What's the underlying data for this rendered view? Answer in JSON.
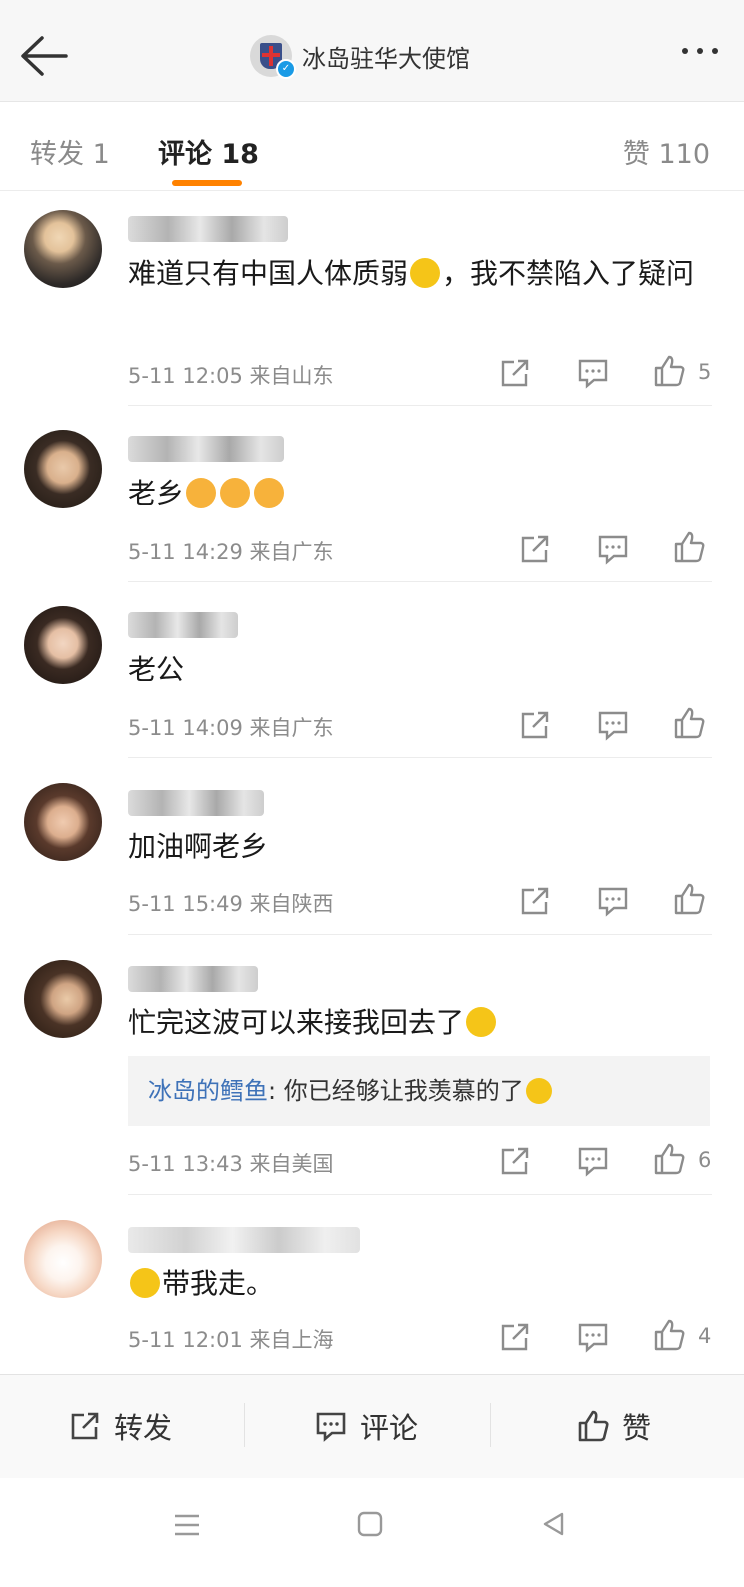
{
  "header": {
    "account_name": "冰岛驻华大使馆"
  },
  "tabs": {
    "repost": "转发 1",
    "comment": "评论 18",
    "like": "赞 110"
  },
  "comments": [
    {
      "text": "难道只有中国人体质弱",
      "text2": "，我不禁陷入了疑问",
      "time": "5-11 12:05",
      "location": "来自山东",
      "likes": "5"
    },
    {
      "text": "老乡",
      "time": "5-11 14:29",
      "location": "来自广东",
      "likes": ""
    },
    {
      "text": "老公",
      "time": "5-11 14:09",
      "location": "来自广东",
      "likes": ""
    },
    {
      "text": "加油啊老乡",
      "time": "5-11 15:49",
      "location": "来自陕西",
      "likes": ""
    },
    {
      "text": "忙完这波可以来接我回去了",
      "reply_name": "冰岛的鳕鱼",
      "reply_text": ": 你已经够让我羡慕的了",
      "time": "5-11 13:43",
      "location": "来自美国",
      "likes": "6"
    },
    {
      "text": "带我走。",
      "time": "5-11 12:01",
      "location": "来自上海",
      "likes": "4"
    }
  ],
  "bottom_bar": {
    "repost": "转发",
    "comment": "评论",
    "like": "赞"
  },
  "icons": [
    "back-arrow-icon",
    "more-icon",
    "verified-icon",
    "share-icon",
    "comment-icon",
    "like-icon",
    "menu-icon",
    "home-icon",
    "back-icon"
  ],
  "colors": {
    "accent": "#ff8200",
    "link": "#3e72b8",
    "verify": "#1a9be6"
  }
}
